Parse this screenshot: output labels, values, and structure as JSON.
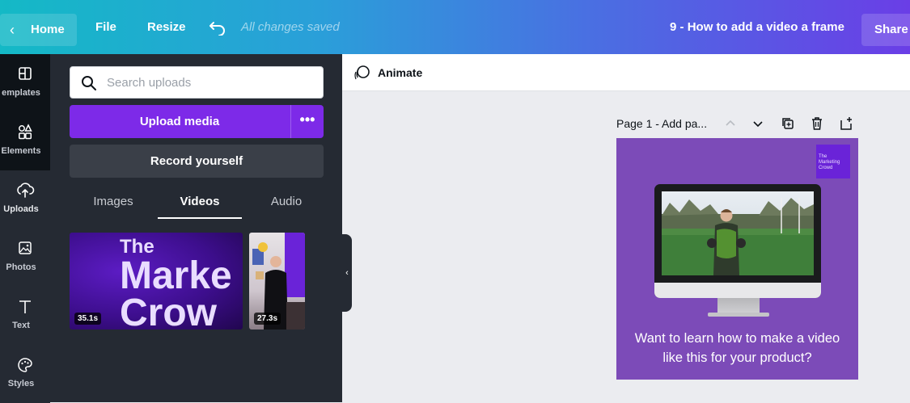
{
  "topbar": {
    "home_label": "Home",
    "file_label": "File",
    "resize_label": "Resize",
    "saved_status": "All changes saved",
    "design_title": "9 - How to add a video a frame",
    "share_label": "Share"
  },
  "rail": {
    "items": [
      {
        "label": "emplates",
        "icon": "templates-icon"
      },
      {
        "label": "Elements",
        "icon": "elements-icon"
      },
      {
        "label": "Uploads",
        "icon": "upload-cloud-icon"
      },
      {
        "label": "Photos",
        "icon": "photos-icon"
      },
      {
        "label": "Text",
        "icon": "text-icon"
      },
      {
        "label": "Styles",
        "icon": "palette-icon"
      }
    ]
  },
  "panel": {
    "search_placeholder": "Search uploads",
    "upload_label": "Upload media",
    "more_label": "•••",
    "record_label": "Record yourself",
    "tabs": [
      "Images",
      "Videos",
      "Audio"
    ],
    "active_tab": "Videos",
    "videos": [
      {
        "duration": "35.1s",
        "text_lines": [
          "The",
          "Marke",
          "Crow"
        ]
      },
      {
        "duration": "27.3s"
      }
    ]
  },
  "editor": {
    "animate_label": "Animate",
    "page_label": "Page 1 - Add pa...",
    "page_controls": [
      "chevron-up-icon",
      "chevron-down-icon",
      "duplicate-page-icon",
      "delete-page-icon",
      "add-page-icon"
    ]
  },
  "design": {
    "logo_lines": [
      "The",
      "Marketing",
      "Crowd"
    ],
    "caption_line1": "Want to learn how to make a video",
    "caption_line2": "like this for your product?",
    "background_color": "#7c4bb8"
  },
  "colors": {
    "accent_purple": "#7d2ae8",
    "panel_bg": "#252a33",
    "rail_bg": "#0e1318"
  }
}
